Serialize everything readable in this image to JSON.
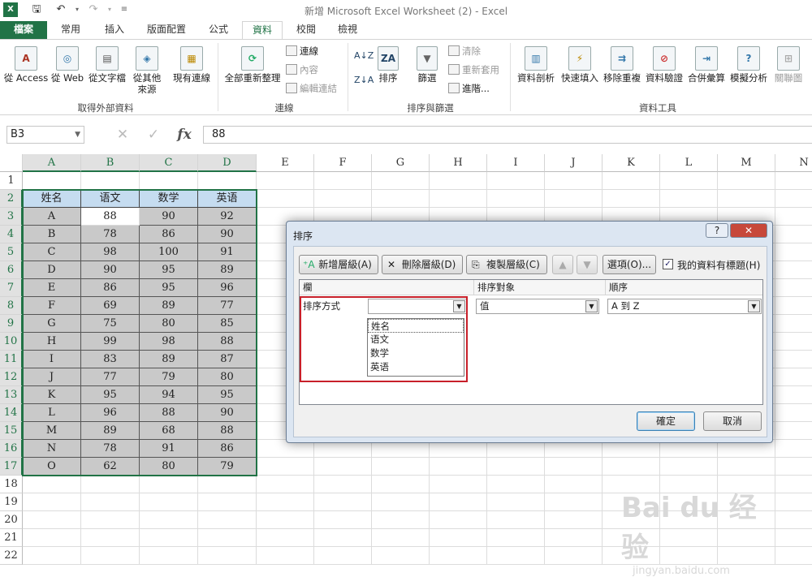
{
  "window": {
    "title": "新增 Microsoft Excel Worksheet (2) - Excel"
  },
  "qat": {
    "save_icon": "save-icon",
    "undo_icon": "undo-icon",
    "redo_icon": "redo-icon"
  },
  "tabs": [
    {
      "label": "檔案"
    },
    {
      "label": "常用"
    },
    {
      "label": "插入"
    },
    {
      "label": "版面配置"
    },
    {
      "label": "公式"
    },
    {
      "label": "資料"
    },
    {
      "label": "校閱"
    },
    {
      "label": "檢視"
    }
  ],
  "ribbon": {
    "ext": {
      "access": "從 Access",
      "web": "從 Web",
      "text": "從文字檔",
      "other1": "從其他",
      "other2": "來源",
      "existing": "現有連線",
      "group": "取得外部資料"
    },
    "conn": {
      "refresh": "全部重新整理",
      "links": "連線",
      "props": "內容",
      "editlinks": "編輯連結",
      "group": "連線"
    },
    "sort": {
      "sort": "排序",
      "filter": "篩選",
      "clear": "清除",
      "reapply": "重新套用",
      "adv": "進階...",
      "group": "排序與篩選"
    },
    "tools": {
      "t2c": "資料剖析",
      "flash": "快速填入",
      "dup": "移除重複",
      "valid": "資料驗證",
      "consol": "合併彙算",
      "whatif": "模擬分析",
      "rel": "關聯圖",
      "group": "資料工具"
    }
  },
  "formula": {
    "namebox": "B3",
    "cancel": "✕",
    "enter": "✓",
    "fx": "fx",
    "value": "88"
  },
  "sheet": {
    "cols": [
      "A",
      "B",
      "C",
      "D",
      "E",
      "F",
      "G",
      "H",
      "I",
      "J",
      "K",
      "L",
      "M",
      "N"
    ],
    "rows": [
      "1",
      "2",
      "3",
      "4",
      "5",
      "6",
      "7",
      "8",
      "9",
      "10",
      "11",
      "12",
      "13",
      "14",
      "15",
      "16",
      "17",
      "18",
      "19",
      "20",
      "21",
      "22"
    ],
    "header": [
      "姓名",
      "语文",
      "数学",
      "英语"
    ],
    "data": [
      [
        "A",
        "88",
        "90",
        "92"
      ],
      [
        "B",
        "78",
        "86",
        "90"
      ],
      [
        "C",
        "98",
        "100",
        "91"
      ],
      [
        "D",
        "90",
        "95",
        "89"
      ],
      [
        "E",
        "86",
        "95",
        "96"
      ],
      [
        "F",
        "69",
        "89",
        "77"
      ],
      [
        "G",
        "75",
        "80",
        "85"
      ],
      [
        "H",
        "99",
        "98",
        "88"
      ],
      [
        "I",
        "83",
        "89",
        "87"
      ],
      [
        "J",
        "77",
        "79",
        "80"
      ],
      [
        "K",
        "95",
        "94",
        "95"
      ],
      [
        "L",
        "96",
        "88",
        "90"
      ],
      [
        "M",
        "89",
        "68",
        "88"
      ],
      [
        "N",
        "78",
        "91",
        "86"
      ],
      [
        "O",
        "62",
        "80",
        "79"
      ]
    ]
  },
  "dialog": {
    "title": "排序",
    "help": "?",
    "close": "✕",
    "add_level": "新增層級(A)",
    "delete_level": "刪除層級(D)",
    "copy_level": "複製層級(C)",
    "up": "▲",
    "down": "▼",
    "options": "選項(O)...",
    "has_header": "我的資料有標題(H)",
    "col_header": "欄",
    "sorton_header": "排序對象",
    "order_header": "順序",
    "row_label": "排序方式",
    "sort_on_value": "值",
    "order_value": "A 到 Z",
    "dropdown_options": [
      "姓名",
      "语文",
      "数学",
      "英语"
    ],
    "ok": "確定",
    "cancel": "取消"
  },
  "watermark": {
    "big": "Bai du 经验",
    "small": "jingyan.baidu.com"
  }
}
